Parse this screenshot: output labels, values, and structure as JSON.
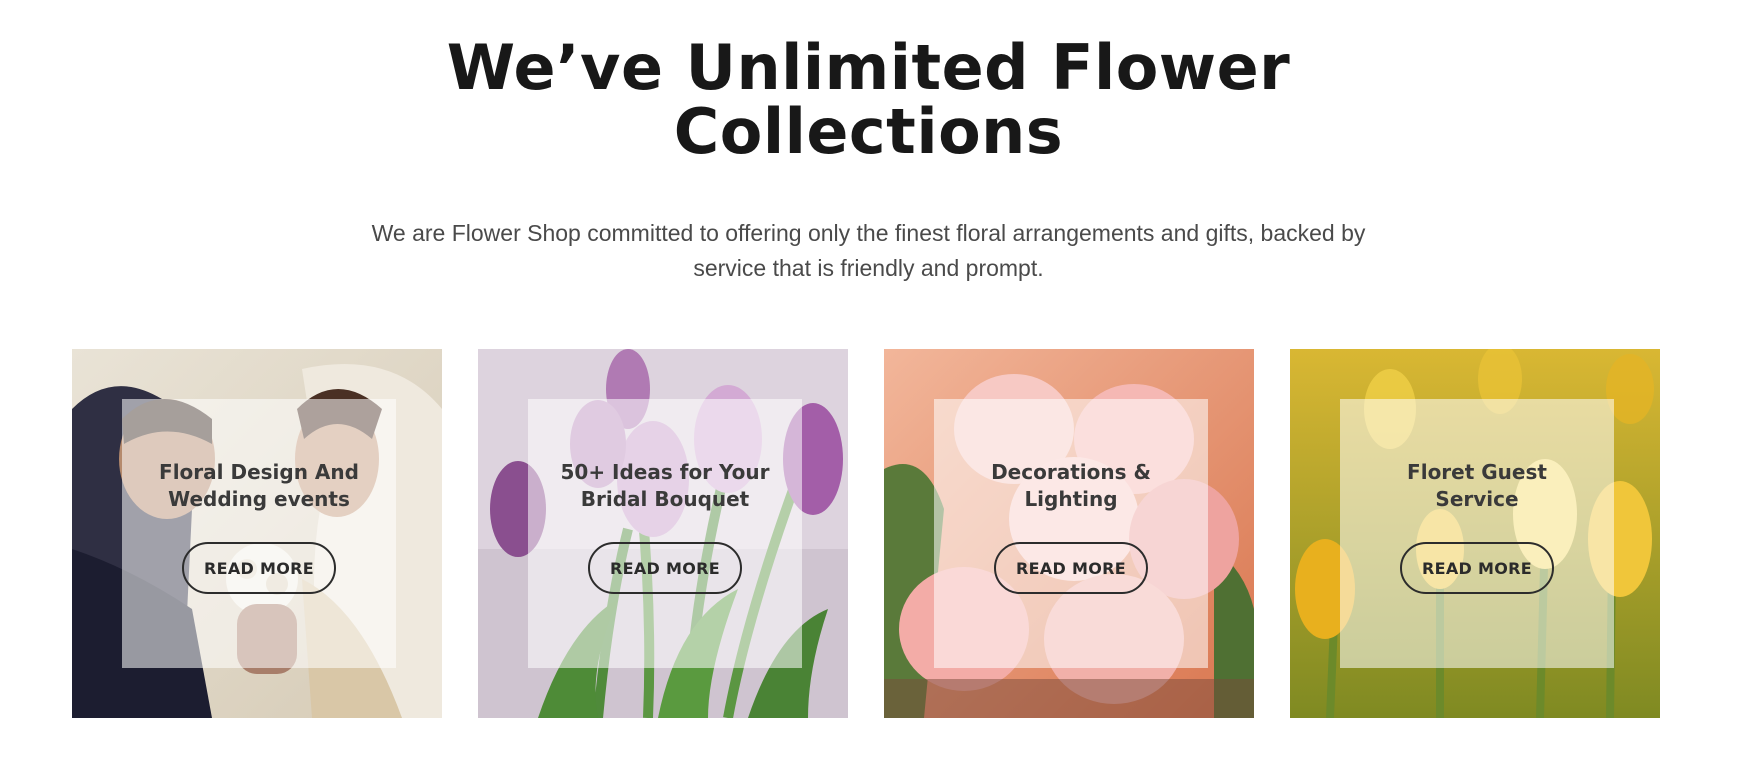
{
  "heading": {
    "line1": "We’ve Unlimited Flower",
    "line2": "Collections"
  },
  "subtitle": "We are Flower Shop committed to offering only the finest floral arrangements and gifts, backed by service that is friendly and prompt.",
  "cards": [
    {
      "title_line1": "Floral Design And",
      "title_line2": "Wedding events",
      "button": "READ MORE",
      "image": "wedding-couple-bouquet"
    },
    {
      "title_line1": "50+ Ideas for Your",
      "title_line2": "Bridal Bouquet",
      "button": "READ MORE",
      "image": "purple-tulips"
    },
    {
      "title_line1": "Decorations &",
      "title_line2": "Lighting",
      "button": "READ MORE",
      "image": "pink-tulips"
    },
    {
      "title_line1": "Floret Guest",
      "title_line2": "Service",
      "button": "READ MORE",
      "image": "yellow-tulips"
    }
  ]
}
